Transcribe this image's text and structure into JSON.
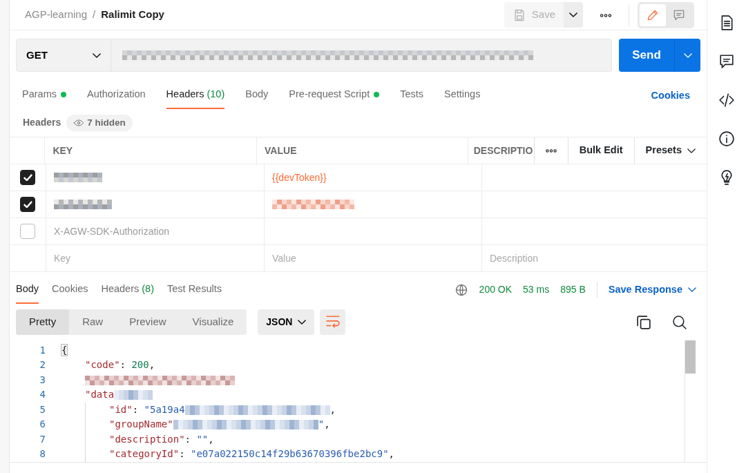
{
  "breadcrumb": {
    "collection": "AGP-learning",
    "separator": "/",
    "request": "Ralimit Copy"
  },
  "toolbar": {
    "save": "Save",
    "save_disabled": true,
    "modes": [
      {
        "kind": "edit",
        "selected": true
      },
      {
        "kind": "comment",
        "selected": false
      }
    ]
  },
  "request": {
    "method": "GET",
    "url_redacted": true,
    "send": "Send"
  },
  "request_tabs": [
    {
      "label": "Params",
      "dot": true,
      "selected": false
    },
    {
      "label": "Authorization",
      "dot": false,
      "selected": false
    },
    {
      "label": "Headers",
      "count": "(10)",
      "dot": false,
      "selected": true
    },
    {
      "label": "Body",
      "dot": false,
      "selected": false
    },
    {
      "label": "Pre-request Script",
      "dot": true,
      "selected": false
    },
    {
      "label": "Tests",
      "dot": false,
      "selected": false
    },
    {
      "label": "Settings",
      "dot": false,
      "selected": false
    }
  ],
  "cookies_link": "Cookies",
  "headers_section": {
    "title": "Headers",
    "hidden": "7 hidden"
  },
  "headers_table": {
    "columns": [
      "KEY",
      "VALUE",
      "DESCRIPTIO"
    ],
    "bulk_edit": "Bulk Edit",
    "presets": "Presets",
    "rows": [
      {
        "checked": true,
        "key_redacted": true,
        "value": "{{devToken}}"
      },
      {
        "checked": true,
        "key_redacted": true,
        "value_redacted": true
      },
      {
        "checked": false,
        "key": "X-AGW-SDK-Authorization"
      }
    ],
    "placeholders": {
      "key": "Key",
      "value": "Value",
      "description": "Description"
    }
  },
  "response_tabs": [
    {
      "label": "Body",
      "selected": true
    },
    {
      "label": "Cookies",
      "selected": false
    },
    {
      "label": "Headers",
      "count": "(8)",
      "selected": false
    },
    {
      "label": "Test Results",
      "selected": false
    }
  ],
  "response_status": {
    "status": "200 OK",
    "time": "53 ms",
    "size": "895 B",
    "save": "Save Response"
  },
  "view_tabs": [
    {
      "label": "Pretty",
      "selected": true
    },
    {
      "label": "Raw",
      "selected": false
    },
    {
      "label": "Preview",
      "selected": false
    },
    {
      "label": "Visualize",
      "selected": false
    }
  ],
  "format": "JSON",
  "code_lines": [
    {
      "number": "1",
      "tokens": [
        {
          "kind": "bracket",
          "text": "{"
        }
      ],
      "children": [
        {
          "number": "2",
          "tokens": [
            {
              "kind": "key",
              "text": "\"code\""
            },
            {
              "kind": "punct",
              "text": ": "
            },
            {
              "kind": "number",
              "text": "200"
            },
            {
              "kind": "punct",
              "text": ","
            }
          ]
        },
        {
          "number": "3",
          "tokens": [
            {
              "kind": "redacted"
            }
          ]
        },
        {
          "number": "4",
          "tokens": [
            {
              "kind": "key",
              "text": "\"data"
            },
            {
              "kind": "redacted"
            }
          ],
          "children": [
            {
              "number": "5",
              "tokens": [
                {
                  "kind": "key",
                  "text": "\"id\""
                },
                {
                  "kind": "punct",
                  "text": ": "
                },
                {
                  "kind": "string",
                  "text": "\"5a19a4"
                },
                {
                  "kind": "redacted"
                },
                {
                  "kind": "punct",
                  "text": ","
                }
              ]
            },
            {
              "number": "6",
              "tokens": [
                {
                  "kind": "key",
                  "text": "\"groupName\""
                },
                {
                  "kind": "redacted"
                },
                {
                  "kind": "string",
                  "text": "\""
                },
                {
                  "kind": "punct",
                  "text": ","
                }
              ]
            },
            {
              "number": "7",
              "tokens": [
                {
                  "kind": "key",
                  "text": "\"description\""
                },
                {
                  "kind": "punct",
                  "text": ": "
                },
                {
                  "kind": "string",
                  "text": "\"\""
                },
                {
                  "kind": "punct",
                  "text": ","
                }
              ]
            },
            {
              "number": "8",
              "tokens": [
                {
                  "kind": "key",
                  "text": "\"categoryId\""
                },
                {
                  "kind": "punct",
                  "text": ": "
                },
                {
                  "kind": "string",
                  "text": "\"e07a022150c14f29b63670396fbe2bc9\""
                },
                {
                  "kind": "punct",
                  "text": ","
                }
              ]
            }
          ]
        }
      ]
    }
  ]
}
